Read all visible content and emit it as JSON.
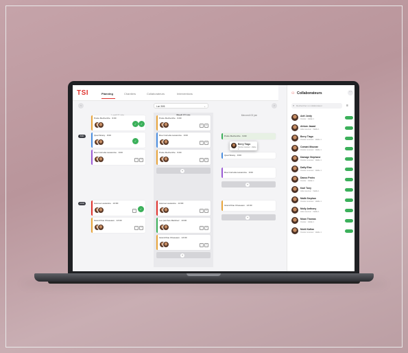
{
  "app": {
    "logo": "TSI"
  },
  "nav": {
    "items": [
      "Planning",
      "Chantiers",
      "Collaborateurs",
      "Interventions"
    ],
    "active": 0
  },
  "toolbar": {
    "prev": "‹",
    "next": "›",
    "date": "Lun 30/6",
    "chevron": "⌄"
  },
  "columns": [
    {
      "label": "Lundi 01 juin",
      "active": false
    },
    {
      "label": "Mardi 02 juin",
      "active": true
    },
    {
      "label": "Mercredi 03 juin",
      "active": false
    }
  ],
  "rows": [
    {
      "tag": "8:00"
    },
    {
      "tag": "13:00"
    }
  ],
  "cards": {
    "c1": "Poste Recherche · 9:00",
    "c2": "Quai Strasy · 9:00",
    "c3": "Rue Cornelia Lavancine · 9:00",
    "c4": "Poste Recherche · 9:00",
    "c5": "Rue Cornelia Lavancine · 9:00",
    "c6": "Poste Recherche · 9:00",
    "c7": "Poste Recherche · 9:00",
    "c8": "Quai Strasy · 9:00",
    "c9": "Rue Cornelia Lavancine · 9:00",
    "c10": "Avenue Lausanne · 13:00",
    "c11": "Grand Rue Cheseaux · 13:00",
    "c12": "Avenue Lausanne · 13:00",
    "c13": "Les perches Martinez · 13:00",
    "c14": "Grand Rue Cheseaux · 13:00",
    "c15": "Grand Rue Cheseaux · 13:00"
  },
  "add_label": "+",
  "drag": {
    "name": "Berry Tiago",
    "role": "Ouvrier couvreur · Valide 1"
  },
  "sidebar": {
    "title": "Collaborateurs",
    "more": "⋯",
    "search_placeholder": "Rechercher un collaborateur",
    "people": [
      {
        "name": "Adri Jordy",
        "role": "Ouvrier · Valide 1"
      },
      {
        "name": "Atrium Jawad",
        "role": "Aide couvreur · Valide 1"
      },
      {
        "name": "Berry Tiago",
        "role": "Ouvrier couvreur · Valide 1"
      },
      {
        "name": "Comani Mounae",
        "role": "Ouvrier couvreur · Valide 1"
      },
      {
        "name": "Damage Stephane",
        "role": "Ouvrier couvreur · Valide 1"
      },
      {
        "name": "Dafty Elsa",
        "role": "Ouvrier couvreur · Valide 1"
      },
      {
        "name": "Danco Pedro",
        "role": "Ouvrier · Valide 1"
      },
      {
        "name": "Kael Tony",
        "role": "Aide couvreur · Valide 1"
      },
      {
        "name": "Malik Stephan",
        "role": "Ouvrier couvreur · Valide 1"
      },
      {
        "name": "Molly Anthony",
        "role": "Aide couvreur · Valide 1"
      },
      {
        "name": "Moan Thomas",
        "role": "Ouvrier · Valide 1"
      },
      {
        "name": "Mohli Kafian",
        "role": "Ouvrier couvreur · Valide 1"
      }
    ]
  },
  "colors": {
    "brand": "#e0322d",
    "accent": "#3bb05a"
  }
}
